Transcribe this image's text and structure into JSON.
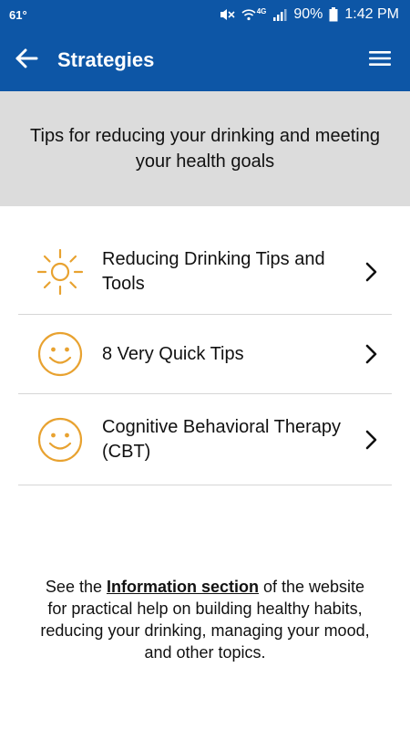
{
  "status_bar": {
    "temperature": "61°",
    "network": "4G",
    "battery": "90%",
    "time": "1:42 PM"
  },
  "app_bar": {
    "title": "Strategies",
    "back_icon": "arrow-left-icon",
    "menu_icon": "hamburger-menu-icon"
  },
  "header": {
    "text": "Tips for reducing your drinking and meeting your health goals"
  },
  "items": [
    {
      "label": "Reducing Drinking Tips and Tools",
      "icon": "sun-icon"
    },
    {
      "label": "8 Very Quick Tips",
      "icon": "smiley-face-icon"
    },
    {
      "label": "Cognitive Behavioral Therapy (CBT)",
      "icon": "smiley-face-icon"
    }
  ],
  "footer": {
    "prefix": "See the ",
    "link": "Information section",
    "suffix": " of the website for practical help on building healthy habits, reducing your drinking, managing your mood, and other topics."
  },
  "colors": {
    "primary": "#0d56a6",
    "accent_icon": "#e8a230",
    "banner_bg": "#dcdcdc",
    "divider": "#d6d6d6"
  }
}
